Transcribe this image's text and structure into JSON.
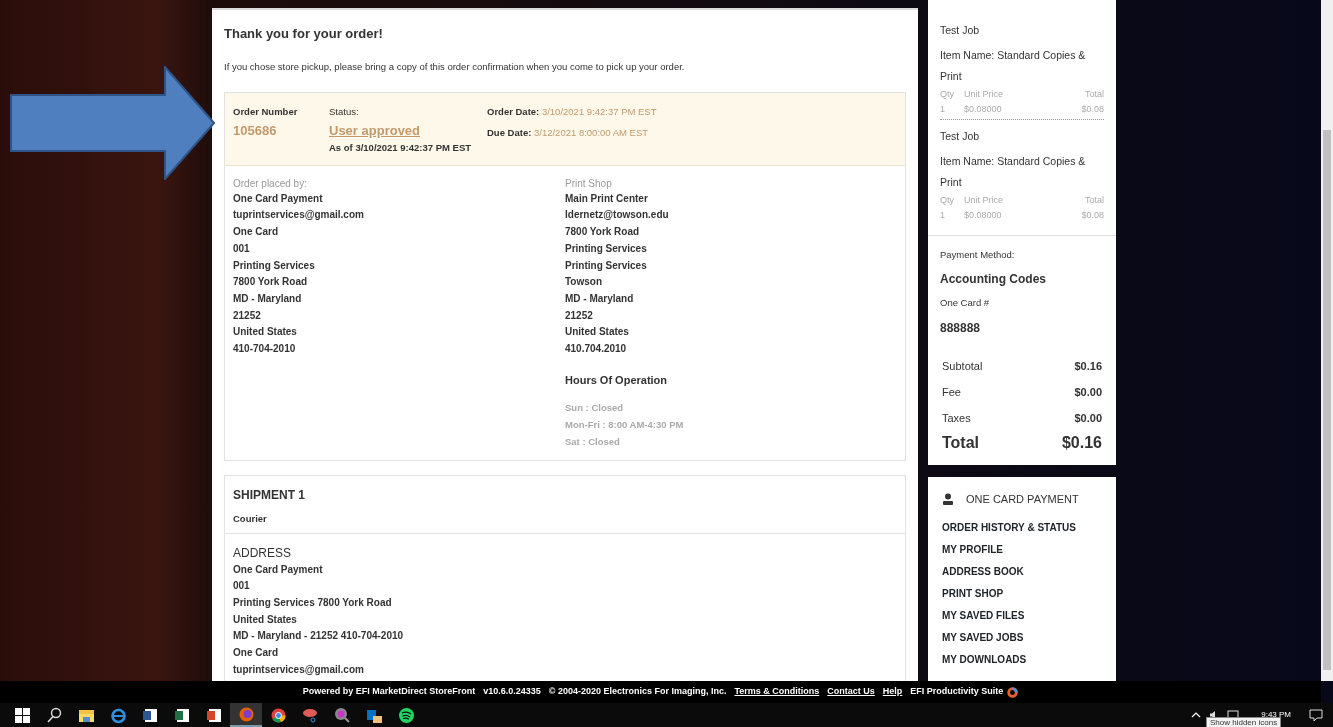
{
  "confirmation": {
    "title": "Thank you for your order!",
    "note": "If you chose store pickup, please bring a copy of this order confirmation when you come to pick up your order."
  },
  "order_summary": {
    "number_label": "Order Number",
    "number": "105686",
    "status_label": "Status:",
    "status": "User approved",
    "as_of": "As of 3/10/2021 9:42:37 PM EST",
    "order_date_label": "Order Date:",
    "order_date": "3/10/2021 9:42:37 PM EST",
    "due_date_label": "Due Date:",
    "due_date": "3/12/2021 8:00:00 AM EST"
  },
  "placed_by": {
    "label": "Order placed by:",
    "lines": [
      "One Card Payment",
      "tuprintservices@gmail.com",
      "One Card",
      "001",
      "Printing Services",
      "7800 York Road",
      "MD - Maryland",
      "21252",
      "United States",
      "410-704-2010"
    ]
  },
  "print_shop": {
    "label": "Print Shop",
    "lines": [
      "Main Print Center",
      "ldernetz@towson.edu",
      "7800 York Road",
      "Printing Services",
      "Printing Services",
      "Towson",
      "MD - Maryland",
      "21252",
      "United States",
      "410.704.2010"
    ],
    "hours_title": "Hours Of Operation",
    "hours": [
      "Sun : Closed",
      "Mon-Fri : 8:00 AM-4:30 PM",
      "Sat : Closed"
    ]
  },
  "shipment": {
    "title": "SHIPMENT 1",
    "method": "Courier",
    "address_title": "ADDRESS",
    "address_lines": [
      "One Card Payment",
      "001",
      "Printing Services 7800 York Road",
      "United States",
      "MD - Maryland - 21252 410-704-2010",
      "One Card",
      "tuprintservices@gmail.com"
    ]
  },
  "products": [
    {
      "job": "Test Job",
      "item_name": "Item Name: Standard Copies & Print",
      "qty_label": "Qty",
      "unit_price_label": "Unit Price",
      "total_label": "Total",
      "qty": "1",
      "unit_price": "$0.08000",
      "total": "$0.08"
    },
    {
      "job": "Test Job",
      "item_name": "Item Name: Standard Copies & Print",
      "qty_label": "Qty",
      "unit_price_label": "Unit Price",
      "total_label": "Total",
      "qty": "1",
      "unit_price": "$0.08000",
      "total": "$0.08"
    }
  ],
  "payment": {
    "label": "Payment Method:",
    "method": "Accounting Codes",
    "card_label": "One Card #",
    "card_number": "888888"
  },
  "totals": [
    {
      "kind": "line",
      "label": "Subtotal",
      "value": "$0.16"
    },
    {
      "kind": "line",
      "label": "Fee",
      "value": "$0.00"
    },
    {
      "kind": "line",
      "label": "Taxes",
      "value": "$0.00"
    },
    {
      "kind": "grand",
      "label": "Total",
      "value": "$0.16"
    }
  ],
  "account_menu": {
    "title": "ONE CARD PAYMENT",
    "items": [
      "ORDER HISTORY & STATUS",
      "MY PROFILE",
      "ADDRESS BOOK",
      "PRINT SHOP",
      "MY SAVED FILES",
      "MY SAVED JOBS",
      "MY DOWNLOADS"
    ]
  },
  "footer": {
    "powered": "Powered by EFI MarketDirect StoreFront",
    "version": "v10.6.0.24335",
    "copyright": "© 2004-2020 Electronics For Imaging, Inc.",
    "links": [
      "Terms & Conditions",
      "Contact Us",
      "Help"
    ],
    "suite": "EFI Productivity Suite"
  },
  "taskbar": {
    "apps": [
      {
        "kind": "start",
        "active": false
      },
      {
        "kind": "search",
        "active": false
      },
      {
        "kind": "folder",
        "active": false
      },
      {
        "kind": "edge",
        "active": false
      },
      {
        "kind": "word",
        "active": false
      },
      {
        "kind": "excel",
        "active": false
      },
      {
        "kind": "powerpoint",
        "active": false
      },
      {
        "kind": "firefox",
        "active": true
      },
      {
        "kind": "chrome",
        "active": false
      },
      {
        "kind": "snip",
        "active": false
      },
      {
        "kind": "magnifier",
        "active": false
      },
      {
        "kind": "outlook",
        "active": false
      },
      {
        "kind": "spotify",
        "active": false
      }
    ],
    "time": "9:43 PM",
    "tooltip": "Show hidden icons"
  }
}
